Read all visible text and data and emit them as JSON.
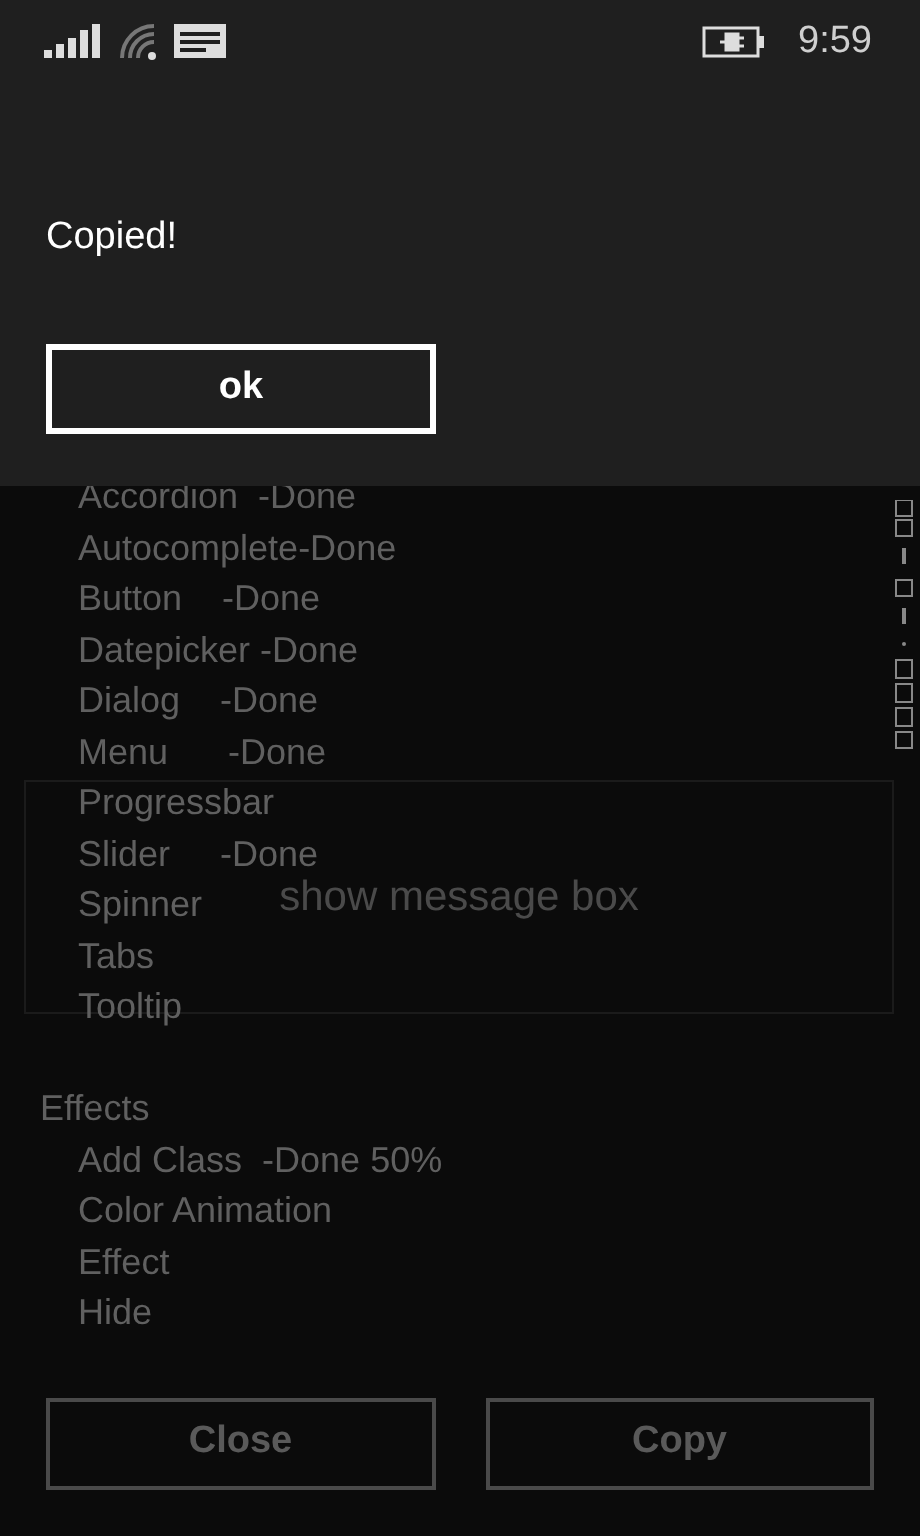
{
  "status_bar": {
    "time": "9:59"
  },
  "dialog": {
    "message": "Copied!",
    "button": "ok"
  },
  "show_button": {
    "label": "show message box"
  },
  "groups": [
    {
      "items": [
        "Accordion  -Done",
        "Autocomplete-Done",
        "Button    -Done",
        "Datepicker -Done",
        "Dialog    -Done",
        "Menu      -Done",
        "Progressbar",
        "Slider     -Done",
        "Spinner",
        "Tabs",
        "Tooltip"
      ]
    },
    {
      "title": "Effects",
      "items": [
        "Add Class  -Done 50%",
        "Color Animation",
        "Effect",
        "Hide"
      ]
    }
  ],
  "buttons": [
    "Close",
    "Copy"
  ]
}
